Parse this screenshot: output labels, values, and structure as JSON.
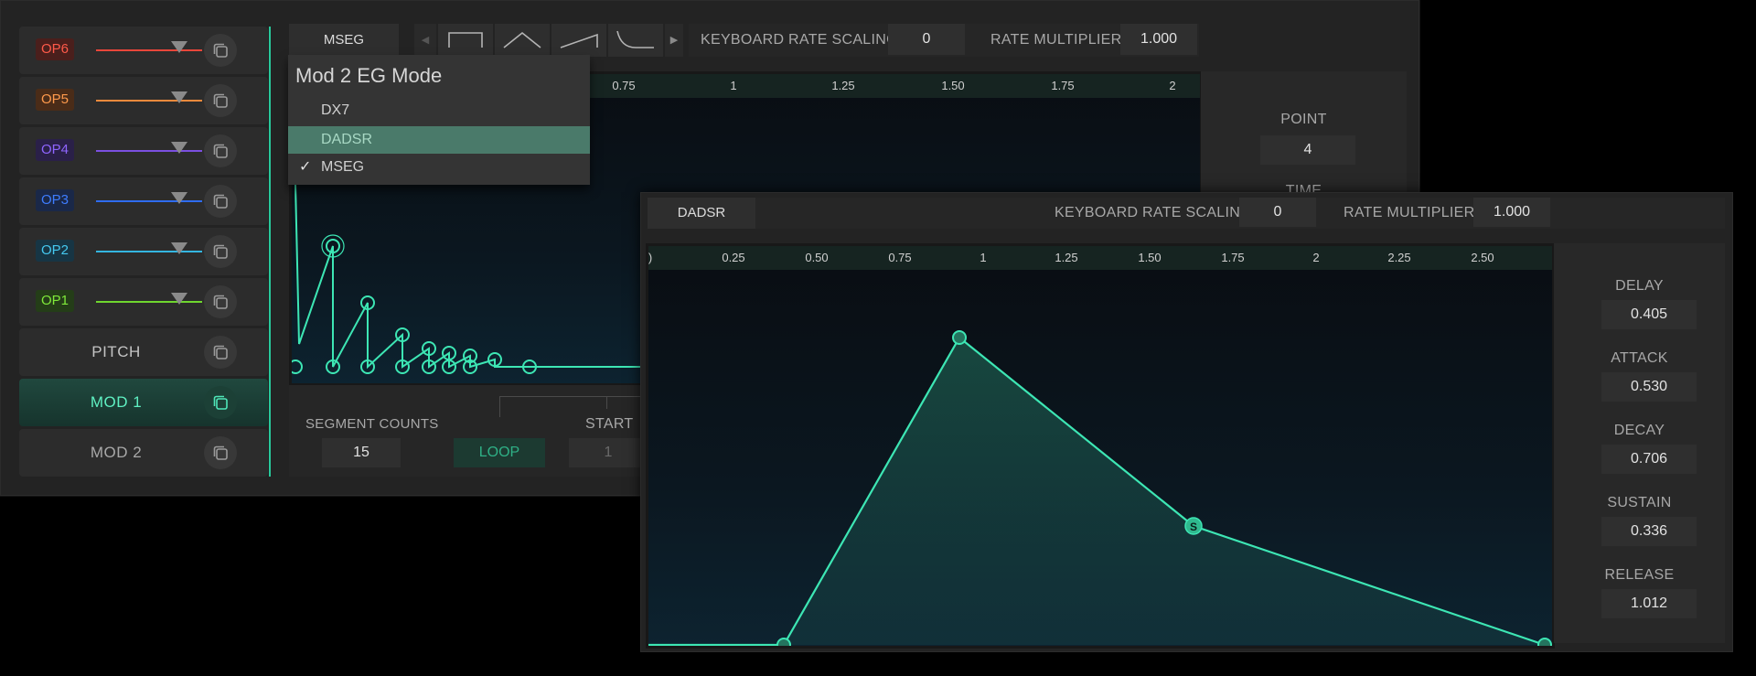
{
  "colors": {
    "accent": "#3de6b4",
    "op6": "#e8463a",
    "op5": "#f08a3c",
    "op4": "#7b4fe0",
    "op3": "#2f6cf0",
    "op2": "#34b6e0",
    "op1": "#6fd62f"
  },
  "sidebar": {
    "ops": [
      {
        "label": "OP6"
      },
      {
        "label": "OP5"
      },
      {
        "label": "OP4"
      },
      {
        "label": "OP3"
      },
      {
        "label": "OP2"
      },
      {
        "label": "OP1"
      }
    ],
    "pitch_label": "PITCH",
    "mod1_label": "MOD 1",
    "mod2_label": "MOD 2",
    "copy_icon": "copy-icon"
  },
  "main": {
    "mode_button": "MSEG",
    "keyboard_rate_scaling_label": "KEYBOARD RATE SCALING",
    "keyboard_rate_scaling_value": "0",
    "rate_multiplier_label": "RATE MULTIPLIER",
    "rate_multiplier_value": "1.000",
    "ruler_ticks": [
      "0.75",
      "1",
      "1.25",
      "1.50",
      "1.75",
      "2"
    ],
    "point_label": "POINT",
    "point_value": "4",
    "time_label": "TIME",
    "segment_counts_label": "SEGMENT COUNTS",
    "segment_counts_value": "15",
    "loop_label": "LOOP",
    "start_label": "START",
    "start_value": "1"
  },
  "dropdown": {
    "title": "Mod 2  EG Mode",
    "items": [
      {
        "label": "DX7",
        "checked": false,
        "highlighted": false
      },
      {
        "label": "DADSR",
        "checked": false,
        "highlighted": true
      },
      {
        "label": "MSEG",
        "checked": true,
        "highlighted": false
      }
    ],
    "check_glyph": "✓"
  },
  "overlay": {
    "mode_button": "DADSR",
    "keyboard_rate_scaling_label": "KEYBOARD RATE SCALING",
    "keyboard_rate_scaling_value": "0",
    "rate_multiplier_label": "RATE MULTIPLIER",
    "rate_multiplier_value": "1.000",
    "ruler_ticks": [
      ")",
      "0.25",
      "0.50",
      "0.75",
      "1",
      "1.25",
      "1.50",
      "1.75",
      "2",
      "2.25",
      "2.50"
    ],
    "sustain_marker": "S",
    "params": [
      {
        "label": "DELAY",
        "value": "0.405"
      },
      {
        "label": "ATTACK",
        "value": "0.530"
      },
      {
        "label": "DECAY",
        "value": "0.706"
      },
      {
        "label": "SUSTAIN",
        "value": "0.336"
      },
      {
        "label": "RELEASE",
        "value": "1.012"
      }
    ]
  }
}
